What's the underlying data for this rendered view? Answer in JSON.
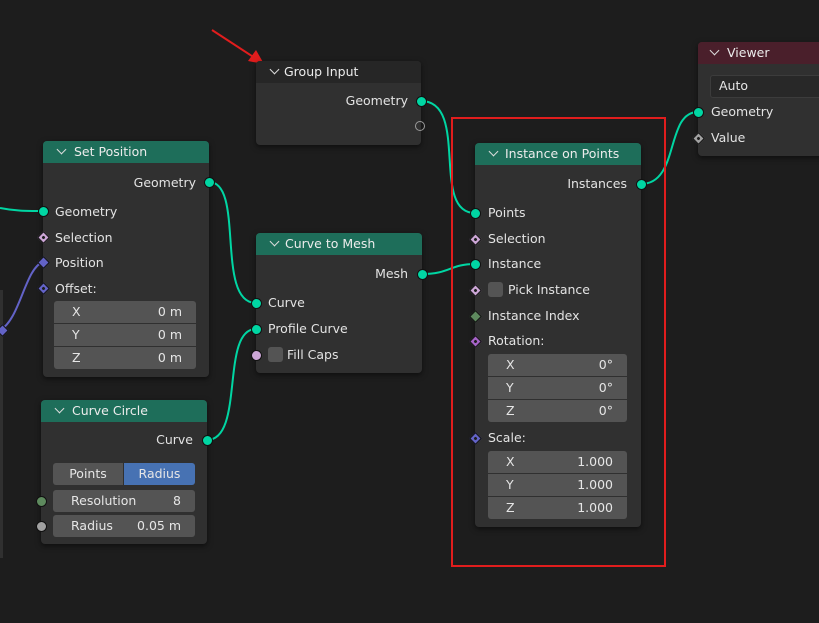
{
  "colors": {
    "background": "#1d1d1d",
    "geometry_socket": "#00d6a3",
    "node_body": "#303030",
    "header_geometry": "#1e6e5a",
    "header_output": "#4a1f2b",
    "highlight": "#e11d1d",
    "arrow": "#e11d1d",
    "active_toggle": "#4772b3"
  },
  "nodes": {
    "group_input": {
      "title": "Group Input",
      "outputs": [
        "Geometry"
      ]
    },
    "set_position": {
      "title": "Set Position",
      "output": "Geometry",
      "inputs": {
        "geometry": "Geometry",
        "selection": "Selection",
        "position": "Position",
        "offset": "Offset:"
      },
      "offset": {
        "x_label": "X",
        "x_value": "0 m",
        "y_label": "Y",
        "y_value": "0 m",
        "z_label": "Z",
        "z_value": "0 m"
      }
    },
    "curve_circle": {
      "title": "Curve Circle",
      "output": "Curve",
      "mode_points": "Points",
      "mode_radius": "Radius",
      "resolution_label": "Resolution",
      "resolution_value": "8",
      "radius_label": "Radius",
      "radius_value": "0.05 m"
    },
    "curve_to_mesh": {
      "title": "Curve to Mesh",
      "output": "Mesh",
      "input_curve": "Curve",
      "input_profile": "Profile Curve",
      "fill_caps": "Fill Caps"
    },
    "instance_on_points": {
      "title": "Instance on Points",
      "output": "Instances",
      "points": "Points",
      "selection": "Selection",
      "instance": "Instance",
      "pick_instance": "Pick Instance",
      "instance_index": "Instance Index",
      "rotation": "Rotation:",
      "rot": {
        "x_label": "X",
        "x_value": "0°",
        "y_label": "Y",
        "y_value": "0°",
        "z_label": "Z",
        "z_value": "0°"
      },
      "scale": "Scale:",
      "scl": {
        "x_label": "X",
        "x_value": "1.000",
        "y_label": "Y",
        "y_value": "1.000",
        "z_label": "Z",
        "z_value": "1.000"
      }
    },
    "viewer": {
      "title": "Viewer",
      "domain_value": "Auto",
      "geometry": "Geometry",
      "value": "Value"
    }
  }
}
